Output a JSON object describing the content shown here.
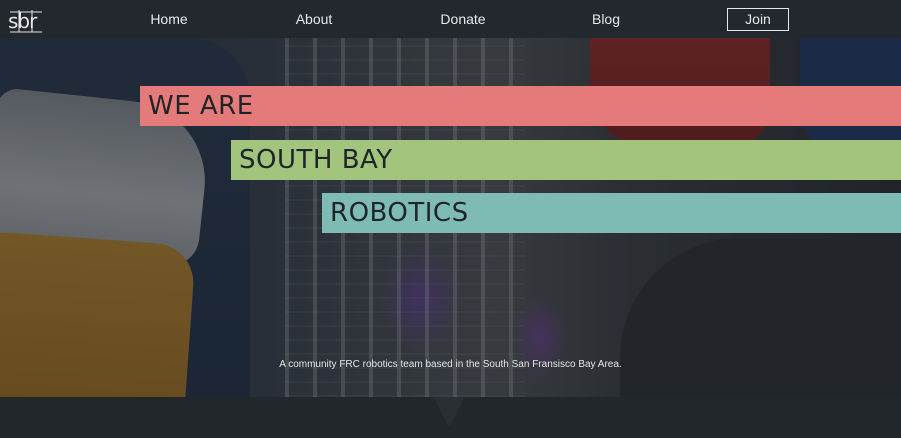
{
  "brand": {
    "logo_text": "sbr"
  },
  "nav": {
    "items": [
      {
        "label": "Home"
      },
      {
        "label": "About"
      },
      {
        "label": "Donate"
      },
      {
        "label": "Blog"
      }
    ],
    "join_label": "Join"
  },
  "hero": {
    "lines": [
      "WE ARE",
      "SOUTH BAY",
      "ROBOTICS"
    ],
    "tagline": "A community FRC robotics team based in the South San Fransisco Bay Area."
  },
  "colors": {
    "band_1": "#e57a7a",
    "band_2": "#a3c47d",
    "band_3": "#7fbbb5",
    "nav_bg": "#23282e"
  },
  "icons": {
    "logo": "sbr-logo",
    "scroll": "scroll-down-arrow-icon"
  }
}
